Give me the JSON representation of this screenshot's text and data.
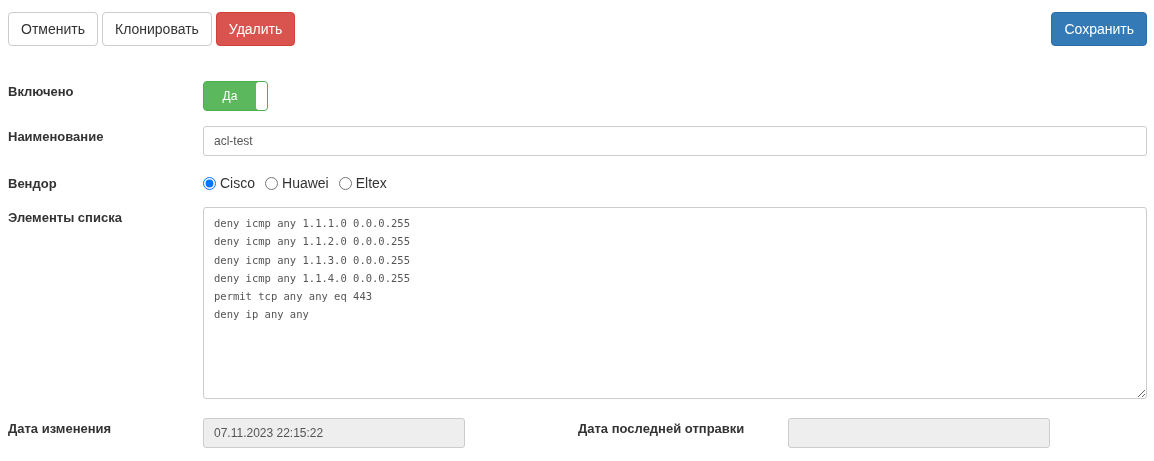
{
  "actions": [
    {
      "label": "Отменить",
      "kind": "default"
    },
    {
      "label": "Клонировать",
      "kind": "default"
    },
    {
      "label": "Удалить",
      "kind": "danger"
    }
  ],
  "save_button": {
    "label": "Сохранить"
  },
  "fields": [
    {
      "kind": "toggle",
      "label": "Включено",
      "on": true,
      "text": "Да"
    },
    {
      "kind": "text",
      "label": "Наименование",
      "value": "acl-test"
    },
    {
      "kind": "radio",
      "label": "Вендор",
      "options": [
        {
          "label": "Cisco",
          "selected": true
        },
        {
          "label": "Huawei",
          "selected": false
        },
        {
          "label": "Eltex",
          "selected": false
        }
      ]
    },
    {
      "kind": "textarea",
      "label": "Элементы списка",
      "lines": [
        "deny icmp any 1.1.1.0 0.0.0.255",
        "deny icmp any 1.1.2.0 0.0.0.255",
        "deny icmp any 1.1.3.0 0.0.0.255",
        "deny icmp any 1.1.4.0 0.0.0.255",
        "permit tcp any any eq 443",
        "deny ip any any"
      ]
    }
  ],
  "dates": [
    {
      "label": "Дата изменения",
      "value": "07.11.2023 22:15:22"
    },
    {
      "label": "Дата последней отправки"
    }
  ]
}
